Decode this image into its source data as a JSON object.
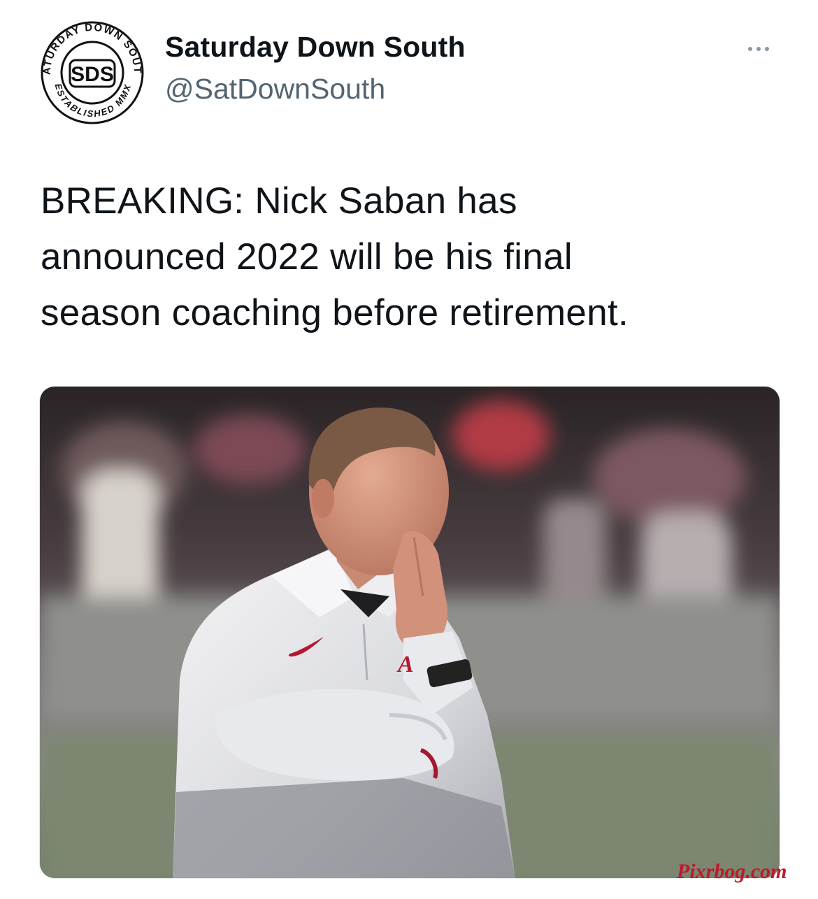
{
  "author": {
    "display_name": "Saturday Down South",
    "handle": "@SatDownSouth",
    "avatar_logo": {
      "center_text": "SDS",
      "top_arc_text": "SATURDAY DOWN SOUTH",
      "bottom_arc_text": "ESTABLISHED MMX",
      "icon": "sds-logo-icon"
    }
  },
  "more_button": {
    "icon": "more-horizontal-icon"
  },
  "tweet": {
    "text_lines": [
      "BREAKING: Nick Saban has",
      "announced 2022 will be his final",
      "season coaching before retirement."
    ]
  },
  "media": {
    "type": "photo",
    "shirt_logo_text": "A"
  },
  "watermark": "Pixrbog.com",
  "colors": {
    "text_primary": "#0f1419",
    "text_secondary": "#536471",
    "watermark": "#c0182c"
  }
}
